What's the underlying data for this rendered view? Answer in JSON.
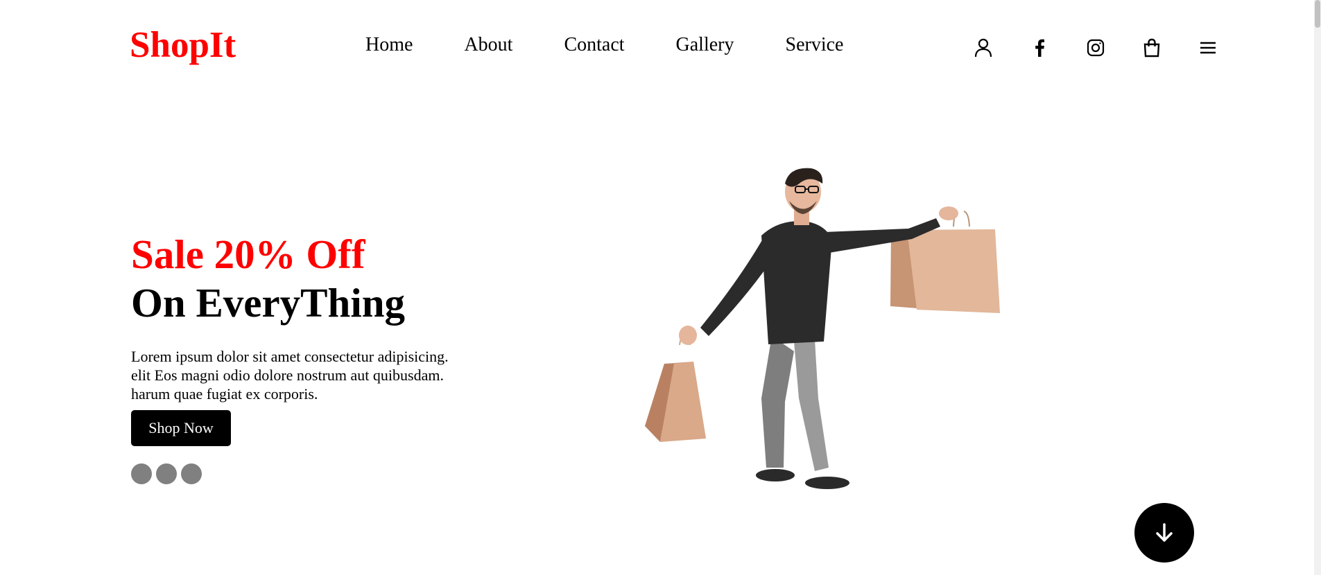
{
  "brand": {
    "logo": "ShopIt",
    "color": "#ff0000"
  },
  "nav": {
    "items": [
      {
        "label": "Home"
      },
      {
        "label": "About"
      },
      {
        "label": "Contact"
      },
      {
        "label": "Gallery"
      },
      {
        "label": "Service"
      }
    ]
  },
  "header_icons": [
    "user-icon",
    "facebook-icon",
    "instagram-icon",
    "shopping-bag-icon",
    "menu-icon"
  ],
  "hero": {
    "title_line1": "Sale 20% Off",
    "title_line2": "On EveryThing",
    "title_accent_color": "#ff0000",
    "description_lines": [
      "Lorem ipsum dolor sit amet consectetur adipisicing.",
      "elit Eos magni odio dolore nostrum aut quibusdam.",
      "harum quae fugiat ex corporis."
    ],
    "cta_label": "Shop Now",
    "slider_dots": 3,
    "image_subject": "man holding shopping bags"
  },
  "scroll_down_icon": "arrow-down-icon"
}
